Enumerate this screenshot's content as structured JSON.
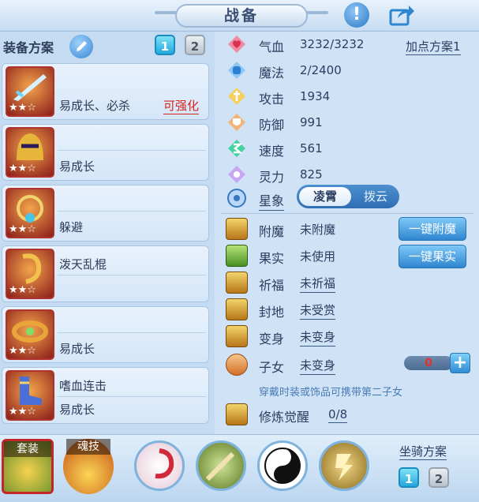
{
  "header": {
    "title": "战备"
  },
  "left": {
    "plan_label": "装备方案",
    "plan_tabs": [
      "1",
      "2"
    ],
    "slots": [
      {
        "line1": "易成长、必杀",
        "enhance": "可强化",
        "line2": "",
        "stars": "★★☆"
      },
      {
        "line1": "",
        "enhance": "",
        "line2": "易成长",
        "stars": "★★☆"
      },
      {
        "line1": "",
        "enhance": "",
        "line2": "躲避",
        "stars": "★★☆"
      },
      {
        "line1": "泼天乱棍",
        "enhance": "",
        "line2": "",
        "stars": "★★☆"
      },
      {
        "line1": "",
        "enhance": "",
        "line2": "易成长",
        "stars": "★★☆"
      },
      {
        "line1": "嗜血连击",
        "enhance": "",
        "line2": "易成长",
        "stars": "★★☆"
      }
    ]
  },
  "stats": {
    "add_points_plan": "加点方案1",
    "rows": [
      {
        "name": "气血",
        "value": "3232/3232"
      },
      {
        "name": "魔法",
        "value": "2/2400"
      },
      {
        "name": "攻击",
        "value": "1934"
      },
      {
        "name": "防御",
        "value": "991"
      },
      {
        "name": "速度",
        "value": "561"
      },
      {
        "name": "灵力",
        "value": "825"
      }
    ],
    "xingxiang": {
      "name": "星象",
      "opt_active": "凌霄",
      "opt_inactive": "拨云"
    }
  },
  "extras": {
    "enchant": {
      "name": "附魔",
      "value": "未附魔",
      "btn": "一键附魔"
    },
    "fruit": {
      "name": "果实",
      "value": "未使用",
      "btn": "一键果实"
    },
    "blessing": {
      "name": "祈福",
      "value": "未祈福"
    },
    "fief": {
      "name": "封地",
      "value": "未受赏"
    },
    "transform": {
      "name": "变身",
      "value": "未变身"
    },
    "child": {
      "name": "子女",
      "value": "未变身",
      "count": "0",
      "plus": "+"
    },
    "child_note": "穿戴时装或饰品可携带第二子女",
    "awaken": {
      "name": "修炼觉醒",
      "value": "0/8"
    }
  },
  "bottom": {
    "set_label": "套装",
    "soul_label": "魂技",
    "mount_label": "坐骑方案",
    "mount_tabs": [
      "1",
      "2"
    ]
  },
  "colors": {
    "accent_blue": "#2f86d0",
    "enhance_red": "#d4261b"
  }
}
